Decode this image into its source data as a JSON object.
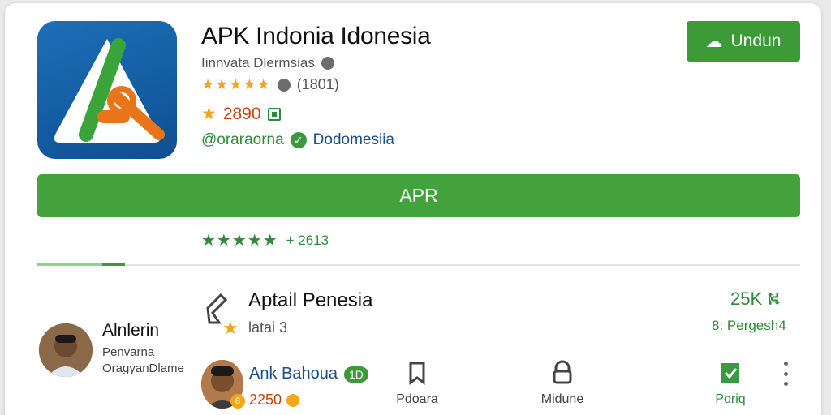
{
  "app": {
    "title": "APK Indonia Idonesia",
    "developer": "Iinnvata Dlermsias",
    "stars": "★★★★★",
    "rating_count": "(1801)",
    "reviews": "2890",
    "category_a": "@oraraorna",
    "category_b": "Dodomesiia",
    "download_label": "Undun",
    "primary_button": "APR",
    "green_stars": "★★★★★",
    "green_rating_text": "+ 2613"
  },
  "list_item": {
    "title": "Aptail Penesia",
    "subtitle": "latai 3",
    "right_value": "25K",
    "right_value_icon": "⛕",
    "right_caption": "8: Pergesh4"
  },
  "user1": {
    "name": "Alnlerin",
    "line1": "Penvarna",
    "line2": "OragyanDlame"
  },
  "user2": {
    "badge": "8",
    "name": "Ank Bahoua",
    "pill": "1D",
    "score": "2250"
  },
  "nav": [
    {
      "label": "Pdoara",
      "icon": "bookmark-icon"
    },
    {
      "label": "Midune",
      "icon": "lock-icon"
    },
    {
      "label": "Poriq",
      "icon": "verified-icon"
    }
  ],
  "colors": {
    "green": "#43a23c",
    "orange": "#c2410c",
    "gold": "#f2a71b",
    "blue": "#1b4e8a"
  }
}
